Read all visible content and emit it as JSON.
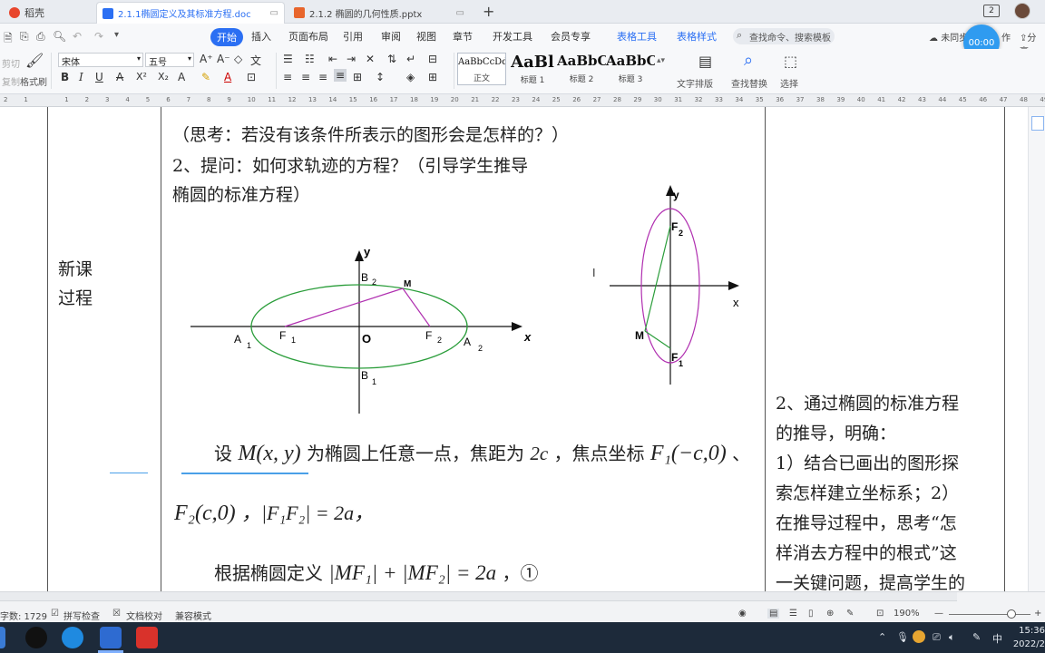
{
  "tabs": [
    {
      "label": "稻壳",
      "icon": "docer-icon",
      "color": "#e8452c"
    },
    {
      "label": "2.1.1椭圆定义及其标准方程.doc",
      "icon": "word-doc-icon",
      "color": "#2b6ff3",
      "active": true
    },
    {
      "label": "2.1.2 椭圆的几何性质.pptx",
      "icon": "ppt-icon",
      "color": "#e8652c"
    }
  ],
  "tabbar": {
    "new_tab": "+",
    "badge": "2"
  },
  "menu": {
    "items": [
      "开始",
      "插入",
      "页面布局",
      "引用",
      "审阅",
      "视图",
      "章节",
      "开发工具",
      "会员专享",
      "表格工具",
      "表格样式"
    ],
    "search_placeholder": "查找命令、搜索模板",
    "sync": "未同步",
    "collab": "作",
    "share": "分享",
    "timer": "00:00"
  },
  "ribbon": {
    "clipboard_cut": "剪切",
    "clipboard_copy": "复制",
    "format_painter": "格式刷",
    "font_name": "宋体",
    "font_size": "五号",
    "styles": [
      {
        "preview": "AaBbCcDd",
        "label": "正文"
      },
      {
        "preview": "AaBl",
        "label": "标题 1"
      },
      {
        "preview": "AaBbC",
        "label": "标题 2"
      },
      {
        "preview": "AaBbC",
        "label": "标题 3"
      }
    ],
    "text_layout": "文字排版",
    "find_replace": "查找替换",
    "select": "选择"
  },
  "document": {
    "row_label_line1": "新课",
    "row_label_line2": "过程",
    "line_think": "（思考：若没有该条件所表示的图形会是怎样的？）",
    "line_q1": "2、提问：如何求轨迹的方程？（引导学生推导",
    "line_q2": "椭圆的标准方程）",
    "para_set_prefix": "设",
    "para_set_point": "M(x, y)",
    "para_set_mid": "为椭圆上任意一点，焦距为",
    "para_set_2c": "2c",
    "para_set_focus": "，焦点坐标",
    "para_set_f1": "F₁(−c,0)",
    "para_set_sep": "、",
    "para_f2": "F₂(c,0)",
    "para_f1f2": "，|F₁F₂| = 2a，",
    "para_def_prefix": "根据椭圆定义",
    "para_def_eq": "|MF₁| + |MF₂| = 2a",
    "para_def_suffix": "，①",
    "right_col": [
      "2、通过椭圆的标准方程",
      "的推导，明确：",
      "1）结合已画出的图形探",
      "索怎样建立坐标系；2）",
      "在推导过程中，思考“怎",
      "样消去方程中的根式”这",
      "一关键问题，提高学生的"
    ],
    "fig1_labels": {
      "y": "y",
      "x": "x",
      "o": "O",
      "a1": "A",
      "a1s": "1",
      "a2": "A",
      "a2s": "2",
      "b1": "B",
      "b1s": "1",
      "b2": "B",
      "b2s": "2",
      "f1": "F",
      "f1s": "1",
      "f2": "F",
      "f2s": "2",
      "m": "M"
    },
    "fig2_labels": {
      "y": "y",
      "x": "x",
      "f1": "F",
      "f1s": "1",
      "f2": "F",
      "f2s": "2",
      "m": "M"
    }
  },
  "statusbar": {
    "word_count": "字数: 1729",
    "spell_check": "拼写检查",
    "doc_proof": "文档校对",
    "compat_mode": "兼容模式",
    "zoom": "190%"
  },
  "taskbar": {
    "time": "15:36",
    "date": "2022/2"
  }
}
